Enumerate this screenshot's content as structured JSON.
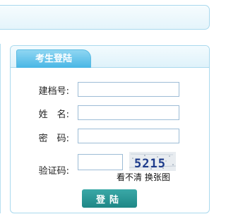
{
  "login": {
    "tab_title": "考生登陆",
    "fields": [
      {
        "label": "建档号:",
        "value": "",
        "placeholder": ""
      },
      {
        "label": "姓　名:",
        "value": "",
        "placeholder": ""
      },
      {
        "label": "密　码:",
        "value": "",
        "placeholder": ""
      }
    ],
    "captcha": {
      "label": "验证码:",
      "value": "",
      "code": "5215",
      "refresh_text": "看不清 换张图"
    },
    "submit_label": "登陆"
  },
  "colors": {
    "accent": "#48b6e5",
    "button": "#1e8786",
    "border": "#a9d9ee"
  }
}
